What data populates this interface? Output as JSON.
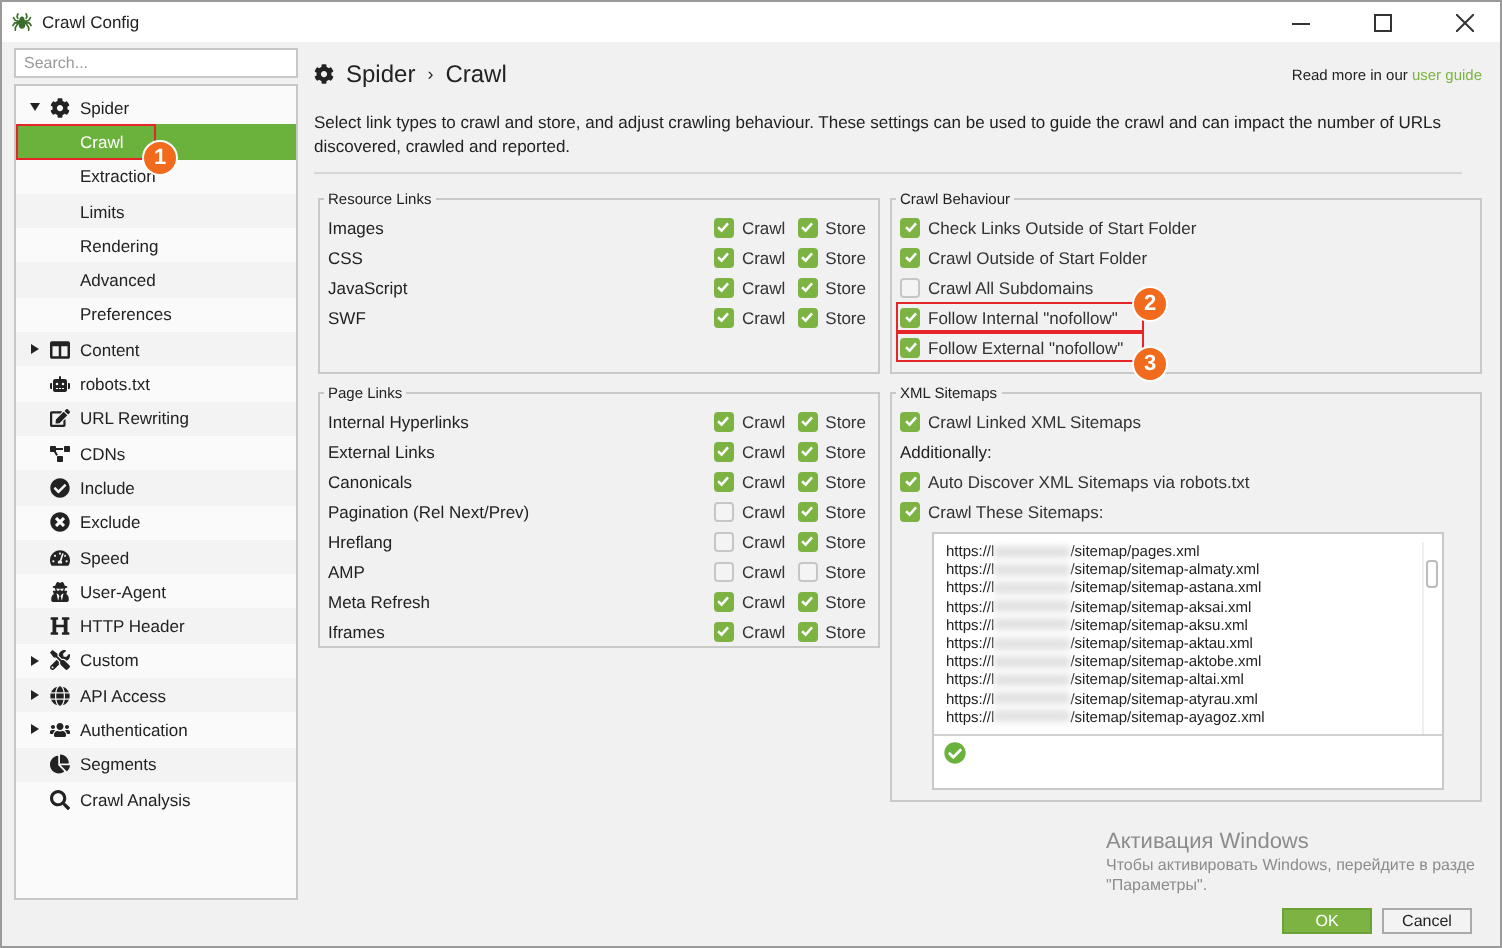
{
  "window": {
    "title": "Crawl Config"
  },
  "sidebar": {
    "search": {
      "placeholder": "Search..."
    },
    "items": [
      {
        "label": "Spider",
        "expanded": true,
        "selected": false,
        "children": [
          {
            "label": "Crawl",
            "selected": true,
            "callout": "1"
          },
          {
            "label": "Extraction",
            "selected": false
          },
          {
            "label": "Limits",
            "selected": false
          },
          {
            "label": "Rendering",
            "selected": false
          },
          {
            "label": "Advanced",
            "selected": false
          },
          {
            "label": "Preferences",
            "selected": false
          }
        ]
      },
      {
        "label": "Content",
        "expanded": false,
        "selected": false
      },
      {
        "label": "robots.txt",
        "selected": false
      },
      {
        "label": "URL Rewriting",
        "selected": false
      },
      {
        "label": "CDNs",
        "selected": false
      },
      {
        "label": "Include",
        "selected": false
      },
      {
        "label": "Exclude",
        "selected": false
      },
      {
        "label": "Speed",
        "selected": false
      },
      {
        "label": "User-Agent",
        "selected": false
      },
      {
        "label": "HTTP Header",
        "selected": false
      },
      {
        "label": "Custom",
        "expanded": false,
        "selected": false
      },
      {
        "label": "API Access",
        "expanded": false,
        "selected": false
      },
      {
        "label": "Authentication",
        "expanded": false,
        "selected": false
      },
      {
        "label": "Segments",
        "selected": false
      },
      {
        "label": "Crawl Analysis",
        "selected": false
      }
    ]
  },
  "header": {
    "breadcrumb": [
      "Spider",
      "Crawl"
    ],
    "separator": "›",
    "help_text": "Read more in our",
    "help_link": "user guide"
  },
  "description": "Select link types to crawl and store, and adjust crawling behaviour. These settings can be used to guide the crawl and can impact the number of URLs discovered, crawled and reported.",
  "resource_links": {
    "title": "Resource Links",
    "rows": [
      {
        "label": "Images",
        "crawl": {
          "text": "Crawl",
          "checked": true
        },
        "store": {
          "text": "Store",
          "checked": true
        }
      },
      {
        "label": "CSS",
        "crawl": {
          "text": "Crawl",
          "checked": true
        },
        "store": {
          "text": "Store",
          "checked": true
        }
      },
      {
        "label": "JavaScript",
        "crawl": {
          "text": "Crawl",
          "checked": true
        },
        "store": {
          "text": "Store",
          "checked": true
        }
      },
      {
        "label": "SWF",
        "crawl": {
          "text": "Crawl",
          "checked": true
        },
        "store": {
          "text": "Store",
          "checked": true
        }
      }
    ]
  },
  "page_links": {
    "title": "Page Links",
    "rows": [
      {
        "label": "Internal Hyperlinks",
        "crawl": {
          "text": "Crawl",
          "checked": true
        },
        "store": {
          "text": "Store",
          "checked": true
        }
      },
      {
        "label": "External Links",
        "crawl": {
          "text": "Crawl",
          "checked": true
        },
        "store": {
          "text": "Store",
          "checked": true
        }
      },
      {
        "label": "Canonicals",
        "crawl": {
          "text": "Crawl",
          "checked": true
        },
        "store": {
          "text": "Store",
          "checked": true
        }
      },
      {
        "label": "Pagination (Rel Next/Prev)",
        "crawl": {
          "text": "Crawl",
          "checked": false
        },
        "store": {
          "text": "Store",
          "checked": true
        }
      },
      {
        "label": "Hreflang",
        "crawl": {
          "text": "Crawl",
          "checked": false
        },
        "store": {
          "text": "Store",
          "checked": true
        }
      },
      {
        "label": "AMP",
        "crawl": {
          "text": "Crawl",
          "checked": false
        },
        "store": {
          "text": "Store",
          "checked": false
        }
      },
      {
        "label": "Meta Refresh",
        "crawl": {
          "text": "Crawl",
          "checked": true
        },
        "store": {
          "text": "Store",
          "checked": true
        }
      },
      {
        "label": "Iframes",
        "crawl": {
          "text": "Crawl",
          "checked": true
        },
        "store": {
          "text": "Store",
          "checked": true
        }
      }
    ]
  },
  "crawl_behaviour": {
    "title": "Crawl Behaviour",
    "options": [
      {
        "label": "Check Links Outside of Start Folder",
        "checked": true
      },
      {
        "label": "Crawl Outside of Start Folder",
        "checked": true
      },
      {
        "label": "Crawl All Subdomains",
        "checked": false
      },
      {
        "label": "Follow Internal \"nofollow\"",
        "checked": true,
        "callout": "2"
      },
      {
        "label": "Follow External \"nofollow\"",
        "checked": true,
        "callout": "3"
      }
    ]
  },
  "xml_sitemaps": {
    "title": "XML Sitemaps",
    "options": [
      {
        "kind": "checkbox",
        "label": "Crawl Linked XML Sitemaps",
        "checked": true
      },
      {
        "kind": "text",
        "label": "Additionally:"
      },
      {
        "kind": "checkbox",
        "label": "Auto Discover XML Sitemaps via robots.txt",
        "checked": true
      },
      {
        "kind": "checkbox",
        "label": "Crawl These Sitemaps:",
        "checked": true
      }
    ],
    "sitemaps": [
      {
        "prefix": "https://l",
        "path": "/sitemap/pages.xml"
      },
      {
        "prefix": "https://l",
        "path": "/sitemap/sitemap-almaty.xml"
      },
      {
        "prefix": "https://l",
        "path": "/sitemap/sitemap-astana.xml"
      },
      {
        "prefix": "https://l",
        "path": "/sitemap/sitemap-aksai.xml"
      },
      {
        "prefix": "https://l",
        "path": "/sitemap/sitemap-aksu.xml"
      },
      {
        "prefix": "https://l",
        "path": "/sitemap/sitemap-aktau.xml"
      },
      {
        "prefix": "https://l",
        "path": "/sitemap/sitemap-aktobe.xml"
      },
      {
        "prefix": "https://l",
        "path": "/sitemap/sitemap-altai.xml"
      },
      {
        "prefix": "https://l",
        "path": "/sitemap/sitemap-atyrau.xml"
      },
      {
        "prefix": "https://l",
        "path": "/sitemap/sitemap-ayagoz.xml"
      }
    ]
  },
  "os_notice": {
    "title": "Активация Windows",
    "text": "Чтобы активировать Windows, перейдите в разде",
    "text2": "\"Параметры\"."
  },
  "buttons": [
    {
      "label": "OK",
      "kind": "primary"
    },
    {
      "label": "Cancel",
      "kind": "secondary"
    }
  ]
}
